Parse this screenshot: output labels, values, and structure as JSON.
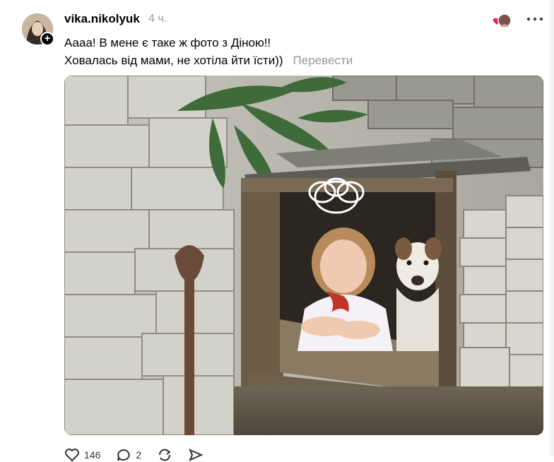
{
  "post": {
    "username": "vika.nikolyuk",
    "timestamp": "4 ч.",
    "text_line1": "Аааа! В мене є таке ж фото з Діною!!",
    "text_line2": "Ховалась від мами, не хотіла йти їсти))",
    "translate_label": "Перевести"
  },
  "actions": {
    "like_count": "146",
    "reply_count": "2"
  },
  "icons": {
    "avatar": "avatar",
    "follow": "plus-icon",
    "reaction": "heart-icon",
    "more": "more-horizontal-icon",
    "like": "heart-outline-icon",
    "reply": "comment-icon",
    "repost": "repost-icon",
    "share": "send-icon"
  },
  "colors": {
    "text": "#000000",
    "muted": "#999999",
    "reaction_heart": "#e0245e"
  }
}
